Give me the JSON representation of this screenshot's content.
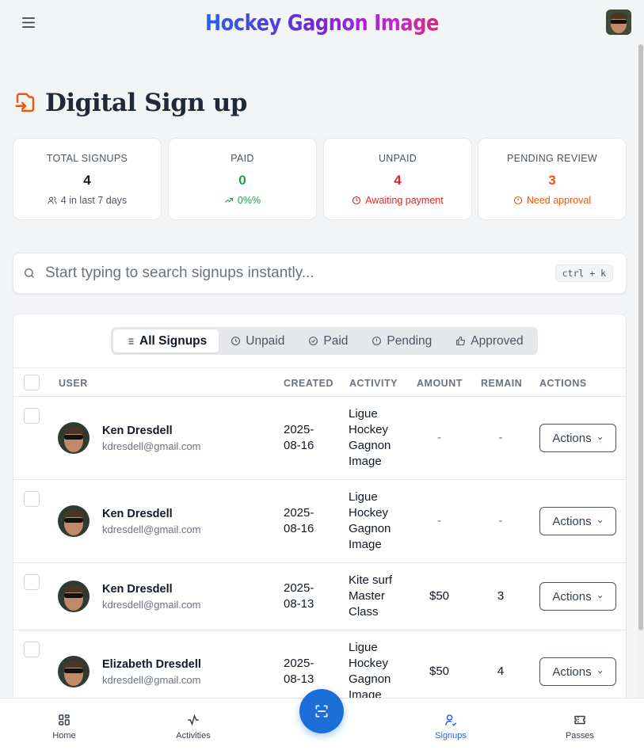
{
  "header": {
    "brand": "Hockey Gagnon Image"
  },
  "page": {
    "title": "Digital Sign up"
  },
  "stats": {
    "total": {
      "label": "TOTAL SIGNUPS",
      "value": "4",
      "sub": "4 in last 7 days"
    },
    "paid": {
      "label": "PAID",
      "value": "0",
      "sub": "0%%"
    },
    "unpaid": {
      "label": "UNPAID",
      "value": "4",
      "sub": "Awaiting payment"
    },
    "pending": {
      "label": "PENDING REVIEW",
      "value": "3",
      "sub": "Need approval"
    }
  },
  "search": {
    "placeholder": "Start typing to search signups instantly...",
    "shortcut": "ctrl + k"
  },
  "tabs": [
    "All Signups",
    "Unpaid",
    "Paid",
    "Pending",
    "Approved"
  ],
  "columns": {
    "user": "USER",
    "created": "CREATED",
    "activity": "ACTIVITY",
    "amount": "AMOUNT",
    "remain": "REMAIN",
    "actions": "ACTIONS"
  },
  "rows": [
    {
      "name": "Ken Dresdell",
      "email": "kdresdell@gmail.com",
      "created": "2025-08-16",
      "activity": "Ligue Hockey Gagnon Image",
      "amount": "-",
      "remain": "-",
      "action": "Actions"
    },
    {
      "name": "Ken Dresdell",
      "email": "kdresdell@gmail.com",
      "created": "2025-08-16",
      "activity": "Ligue Hockey Gagnon Image",
      "amount": "-",
      "remain": "-",
      "action": "Actions"
    },
    {
      "name": "Ken Dresdell",
      "email": "kdresdell@gmail.com",
      "created": "2025-08-13",
      "activity": "Kite surf Master Class",
      "amount": "$50",
      "remain": "3",
      "action": "Actions"
    },
    {
      "name": "Elizabeth Dresdell",
      "email": "kdresdell@gmail.com",
      "created": "2025-08-13",
      "activity": "Ligue Hockey Gagnon Image",
      "amount": "$50",
      "remain": "4",
      "action": "Actions"
    }
  ],
  "nav": {
    "home": "Home",
    "activities": "Activities",
    "signups": "Signups",
    "passes": "Passes"
  },
  "colors": {
    "paid": "#16a34a",
    "unpaid": "#dc2626",
    "pending": "#ea580c",
    "primary": "#1d6fd8"
  }
}
